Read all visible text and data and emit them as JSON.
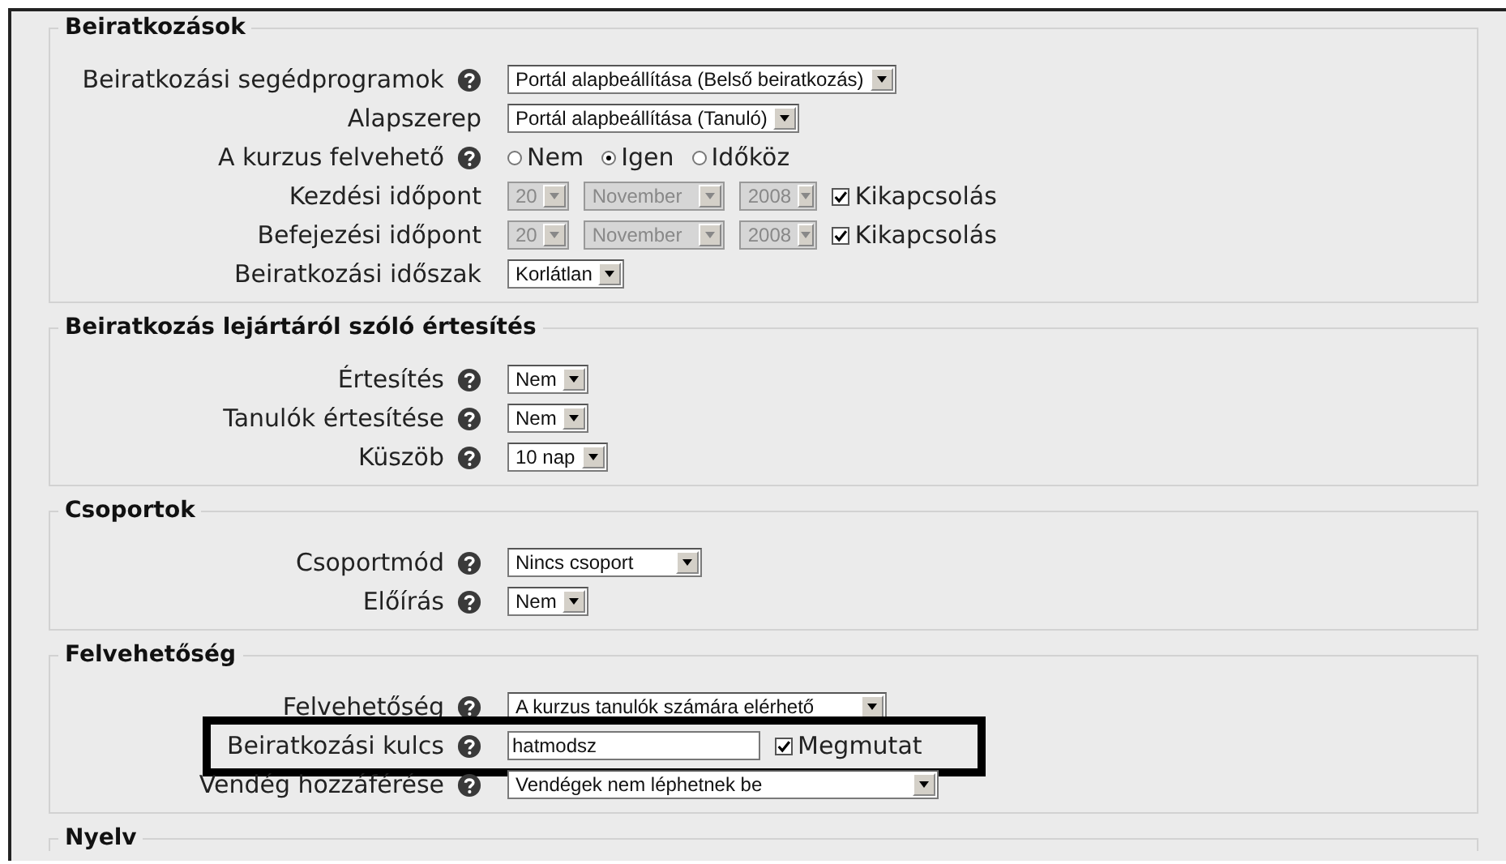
{
  "sections": [
    {
      "legend": "Beiratkozások",
      "rows": [
        {
          "label": "Beiratkozási segédprogramok",
          "help": true,
          "controls": [
            {
              "kind": "select",
              "value": "Portál alapbeállítása (Belső beiratkozás)",
              "disabled": false
            }
          ]
        },
        {
          "label": "Alapszerep",
          "help": false,
          "controls": [
            {
              "kind": "select",
              "value": "Portál alapbeállítása (Tanuló)",
              "disabled": false
            }
          ]
        },
        {
          "label": "A kurzus felvehető",
          "help": true,
          "controls": [
            {
              "kind": "radio",
              "label": "Nem",
              "selected": false
            },
            {
              "kind": "radio",
              "label": "Igen",
              "selected": true
            },
            {
              "kind": "radio",
              "label": "Időköz",
              "selected": false
            }
          ]
        },
        {
          "label": "Kezdési időpont",
          "help": false,
          "controls": [
            {
              "kind": "select",
              "value": "20",
              "disabled": true
            },
            {
              "kind": "select",
              "value": "November",
              "disabled": true
            },
            {
              "kind": "select",
              "value": "2008",
              "disabled": true
            },
            {
              "kind": "checkbox",
              "label": "Kikapcsolás",
              "checked": true
            }
          ]
        },
        {
          "label": "Befejezési időpont",
          "help": false,
          "controls": [
            {
              "kind": "select",
              "value": "20",
              "disabled": true
            },
            {
              "kind": "select",
              "value": "November",
              "disabled": true
            },
            {
              "kind": "select",
              "value": "2008",
              "disabled": true
            },
            {
              "kind": "checkbox",
              "label": "Kikapcsolás",
              "checked": true
            }
          ]
        },
        {
          "label": "Beiratkozási időszak",
          "help": false,
          "controls": [
            {
              "kind": "select",
              "value": "Korlátlan",
              "disabled": false
            }
          ]
        }
      ]
    },
    {
      "legend": "Beiratkozás lejártáról szóló értesítés",
      "rows": [
        {
          "label": "Értesítés",
          "help": true,
          "controls": [
            {
              "kind": "select",
              "value": "Nem",
              "disabled": false
            }
          ]
        },
        {
          "label": "Tanulók értesítése",
          "help": true,
          "controls": [
            {
              "kind": "select",
              "value": "Nem",
              "disabled": false
            }
          ]
        },
        {
          "label": "Küszöb",
          "help": true,
          "controls": [
            {
              "kind": "select",
              "value": "10 nap",
              "disabled": false
            }
          ]
        }
      ]
    },
    {
      "legend": "Csoportok",
      "rows": [
        {
          "label": "Csoportmód",
          "help": true,
          "controls": [
            {
              "kind": "select",
              "value": "Nincs csoport",
              "disabled": false
            }
          ]
        },
        {
          "label": "Előírás",
          "help": true,
          "controls": [
            {
              "kind": "select",
              "value": "Nem",
              "disabled": false
            }
          ]
        }
      ]
    },
    {
      "legend": "Felvehetőség",
      "rows": [
        {
          "label": "Felvehetőség",
          "help": true,
          "controls": [
            {
              "kind": "select",
              "value": "A kurzus tanulók számára elérhető",
              "disabled": false
            }
          ]
        },
        {
          "label": "Beiratkozási kulcs",
          "help": true,
          "highlighted": true,
          "controls": [
            {
              "kind": "text",
              "value": "hatmodsz"
            },
            {
              "kind": "checkbox",
              "label": "Megmutat",
              "checked": true
            }
          ]
        },
        {
          "label": "Vendég hozzáférése",
          "help": true,
          "controls": [
            {
              "kind": "select",
              "value": "Vendégek nem léphetnek be",
              "disabled": false
            }
          ]
        }
      ]
    },
    {
      "legend": "Nyelv"
    }
  ]
}
